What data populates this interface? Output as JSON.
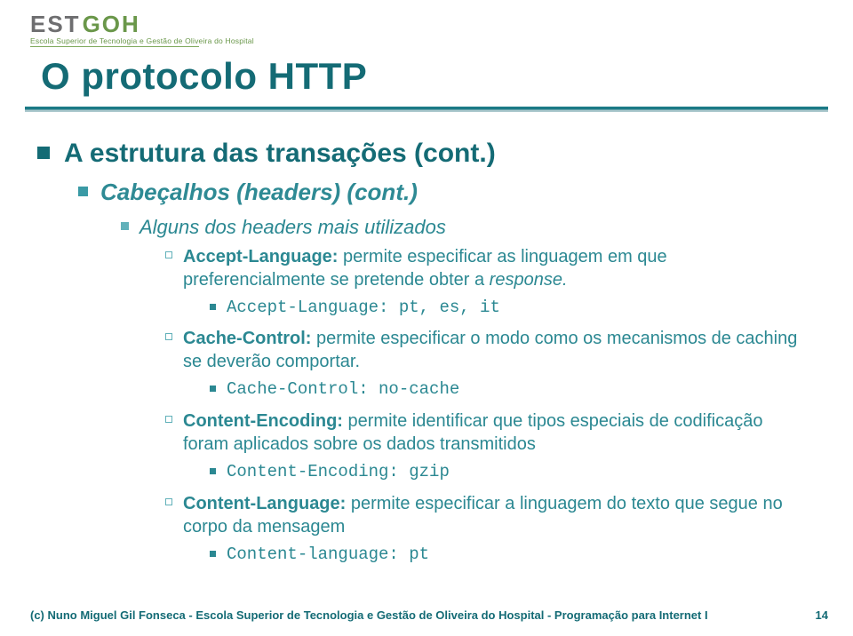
{
  "logo": {
    "left": "EST",
    "right": "GOH",
    "subtitle": "Escola Superior de Tecnologia e Gestão de Oliveira do Hospital"
  },
  "title": "O protocolo HTTP",
  "b1": "A estrutura das transações (cont.)",
  "b2": "Cabeçalhos (headers) (cont.)",
  "b3": "Alguns dos headers mais utilizados",
  "h1_label": "Accept-Language:",
  "h1_desc": " permite especificar as linguagem em que preferencialmente se pretende obter a ",
  "h1_desc_tail": "response.",
  "h1_code": "Accept-Language: pt, es, it",
  "h2_label": "Cache-Control:",
  "h2_desc": " permite especificar o modo como os mecanismos de caching se deverão comportar.",
  "h2_code": "Cache-Control: no-cache",
  "h3_label": "Content-Encoding:",
  "h3_desc": " permite identificar que tipos especiais de codificação foram aplicados sobre os dados transmitidos",
  "h3_code": "Content-Encoding: gzip",
  "h4_label": "Content-Language:",
  "h4_desc": " permite especificar a linguagem do texto que segue no corpo da mensagem",
  "h4_code": "Content-language: pt",
  "footer_left": "(c) Nuno Miguel Gil Fonseca  -  Escola Superior de Tecnologia e Gestão de Oliveira do Hospital  -  Programação para Internet I",
  "page_number": "14"
}
